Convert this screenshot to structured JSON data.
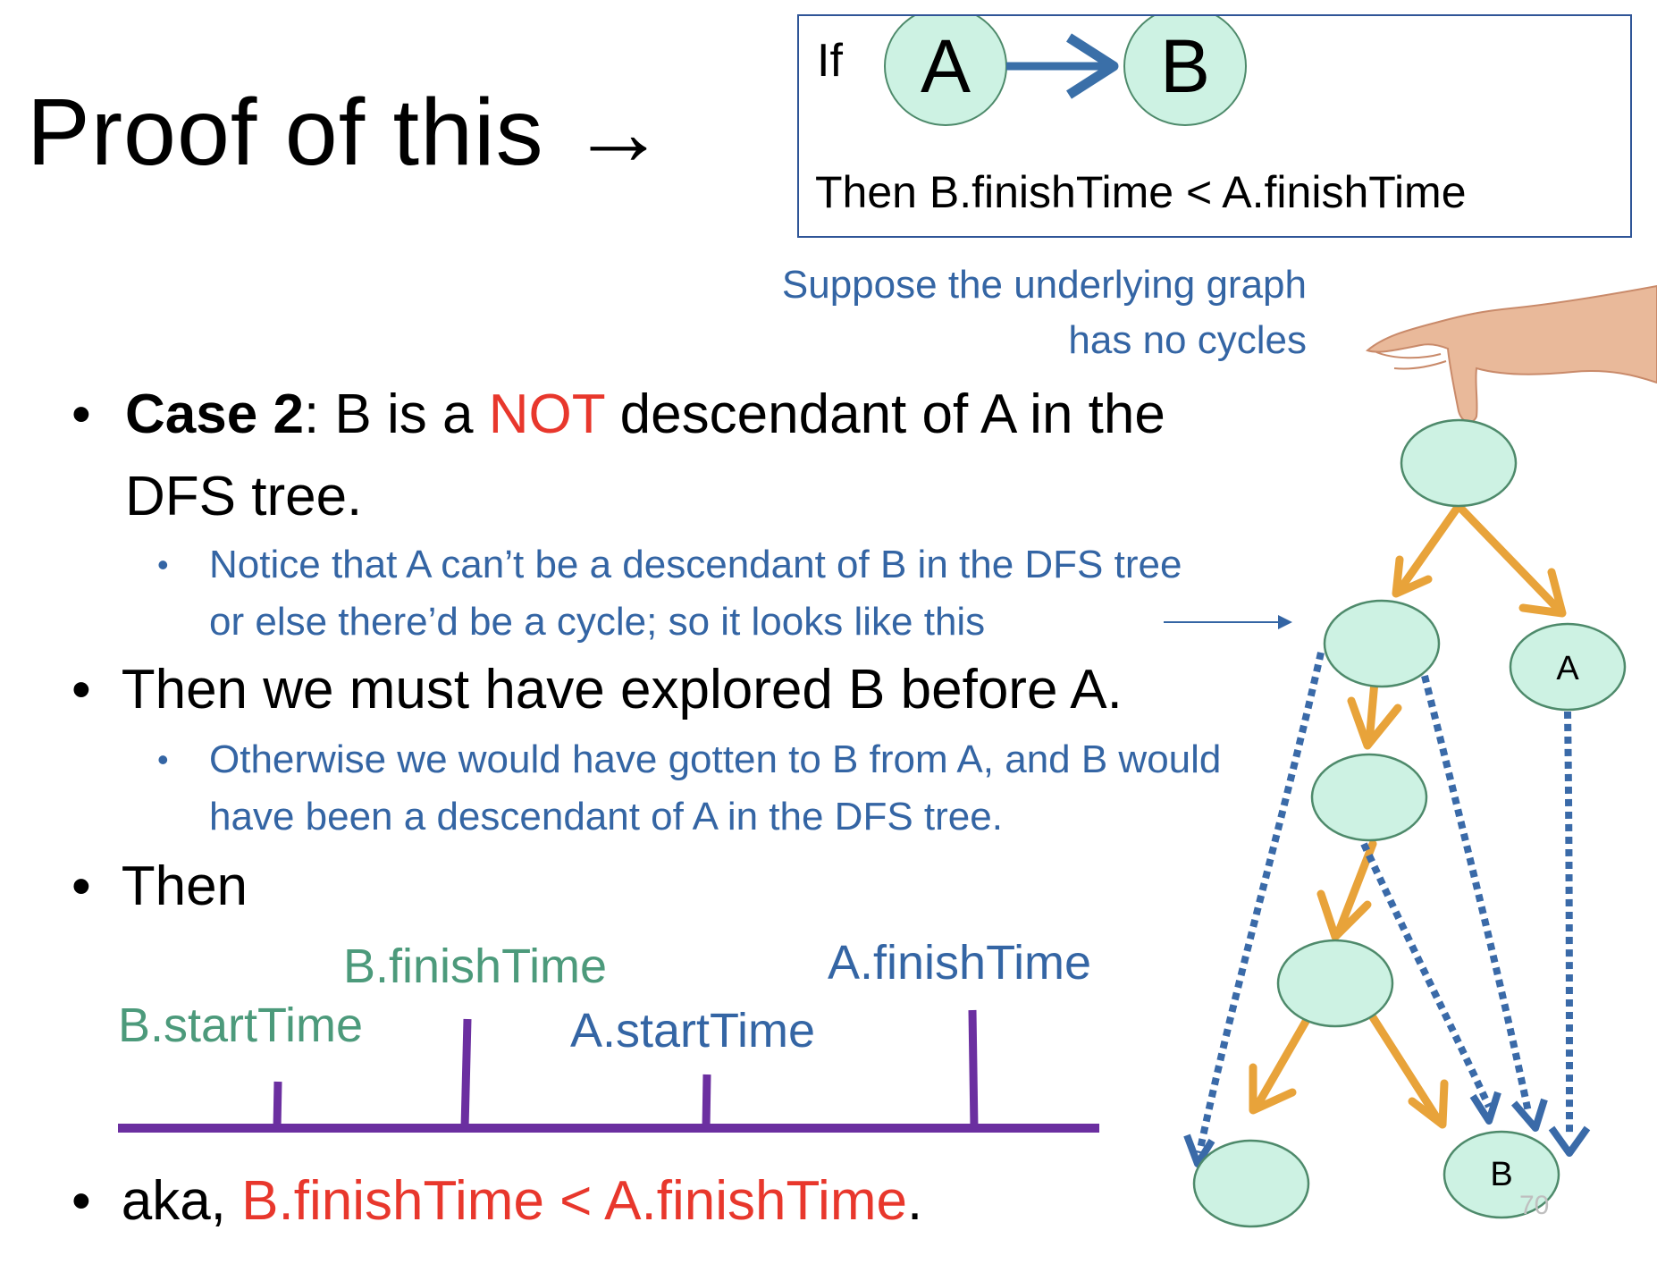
{
  "title": "Proof of this →",
  "claim": {
    "if_label": "If",
    "node_a": "A",
    "node_b": "B",
    "then_text": "Then B.finishTime < A.finishTime"
  },
  "note_suppose": "Suppose the underlying graph has no cycles",
  "bullets": {
    "case": {
      "bold": "Case 2",
      "part1": ": B is a ",
      "highlight": "NOT",
      "part2": " descendant of A in the DFS tree."
    },
    "case_sub": "Notice that A can’t be a descendant of B in the DFS tree or else there’d be a cycle; so it looks like this",
    "explored": "Then we must have explored B before A.",
    "explored_sub": "Otherwise we would have gotten to B from A, and B would have been a descendant of A in the DFS tree.",
    "then": "Then",
    "aka": {
      "prefix": "aka, ",
      "highlight": "B.finishTime < A.finishTime",
      "suffix": "."
    }
  },
  "timeline": {
    "labels": {
      "b_start": "B.startTime",
      "b_finish": "B.finishTime",
      "a_start": "A.startTime",
      "a_finish": "A.finishTime"
    },
    "order": [
      "B.startTime",
      "B.finishTime",
      "A.startTime",
      "A.finishTime"
    ]
  },
  "tree": {
    "label_a": "A",
    "label_b": "B"
  },
  "page_number": "70",
  "colors": {
    "node_fill": "#cdf2e3",
    "node_stroke": "#4e8a6b",
    "tree_edge": "#e8a33a",
    "back_edge": "#3a6aa8",
    "claim_arrow": "#3a6fa8",
    "timeline": "#6b2fa0",
    "text_blue": "#3465a4",
    "text_green": "#4c9a7b",
    "text_red": "#e8372c"
  },
  "icons": [
    "hand-image",
    "right-arrow-icon"
  ]
}
